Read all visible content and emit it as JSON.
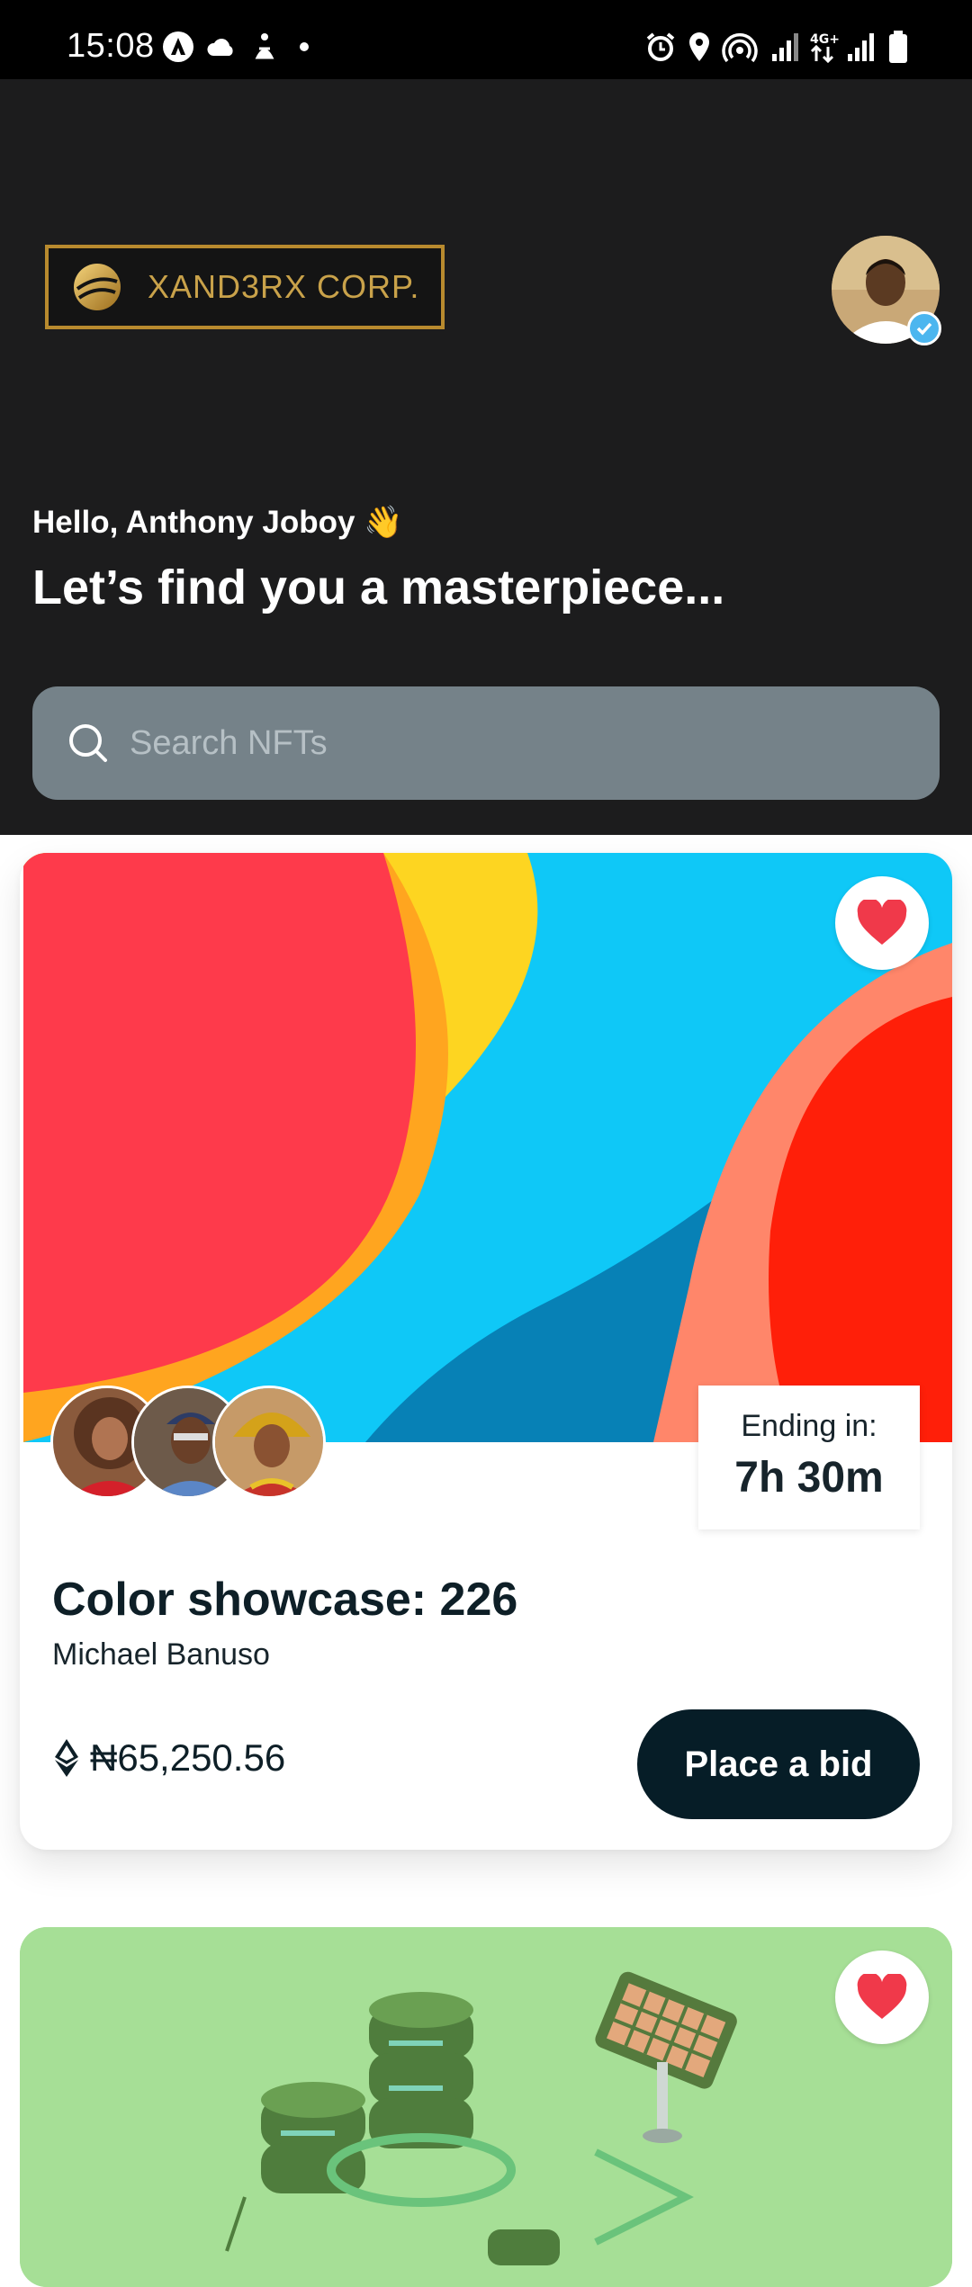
{
  "status_bar": {
    "time": "15:08",
    "icons": [
      "android-auto-icon",
      "cloud-icon",
      "accessibility-icon",
      "dot-icon",
      "alarm-icon",
      "location-icon",
      "hotspot-icon",
      "signal-icon",
      "network-4g-icon",
      "signal-icon",
      "battery-icon"
    ]
  },
  "header": {
    "logo_text": "XAND3RX CORP.",
    "greeting": "Hello, Anthony Joboy 👋",
    "headline": "Let’s find you a masterpiece..."
  },
  "search": {
    "placeholder": "Search NFTs"
  },
  "cards": [
    {
      "title": "Color showcase: 226",
      "creator": "Michael Banuso",
      "ending_label": "Ending in:",
      "ending_value": "7h 30m",
      "price": "₦65,250.56",
      "bid_label": "Place a bid",
      "favorited": true
    },
    {
      "favorited": true
    }
  ],
  "colors": {
    "header_bg": "#1c1c1d",
    "search_bg": "#758289",
    "bid_button": "#061d27",
    "heart": "#f0394a",
    "logo_gold": "#c9a24a"
  }
}
